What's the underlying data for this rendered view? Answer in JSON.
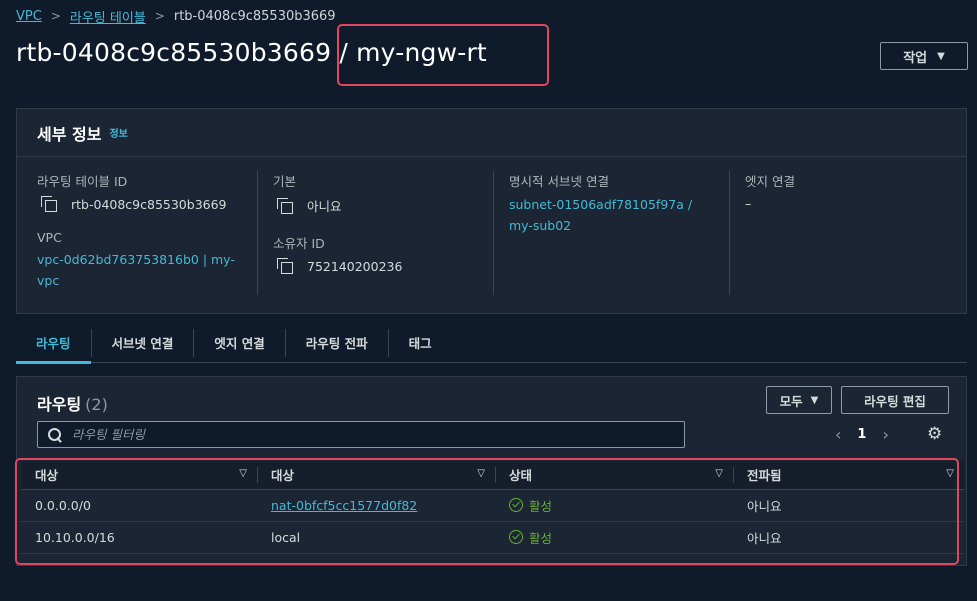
{
  "breadcrumb": {
    "items": [
      "VPC",
      "라우팅 테이블"
    ],
    "current": "rtb-0408c9c85530b3669"
  },
  "header": {
    "title": "rtb-0408c9c85530b3669 / my-ngw-rt",
    "action_label": "작업"
  },
  "details": {
    "title": "세부 정보",
    "info_link": "정보",
    "fields": {
      "route_table_id_label": "라우팅 테이블 ID",
      "route_table_id_value": "rtb-0408c9c85530b3669",
      "vpc_label": "VPC",
      "vpc_value": "vpc-0d62bd763753816b0 | my-vpc",
      "main_label": "기본",
      "main_value": "아니요",
      "owner_label": "소유자 ID",
      "owner_value": "752140200236",
      "subnet_assoc_label": "명시적 서브넷 연결",
      "subnet_assoc_value": "subnet-01506adf78105f97a / my-sub02",
      "edge_assoc_label": "엣지 연결",
      "edge_assoc_value": "–"
    }
  },
  "tabs": [
    "라우팅",
    "서브넷 연결",
    "엣지 연결",
    "라우팅 전파",
    "태그"
  ],
  "routes": {
    "title": "라우팅",
    "count": "(2)",
    "filter_select": "모두",
    "edit_button": "라우팅 편집",
    "search_placeholder": "라우팅 필터링",
    "page": "1",
    "columns": [
      "대상",
      "대상",
      "상태",
      "전파됨"
    ],
    "rows": [
      {
        "destination": "0.0.0.0/0",
        "target": "nat-0bfcf5cc1577d0f82",
        "target_is_link": true,
        "status": "활성",
        "propagated": "아니요"
      },
      {
        "destination": "10.10.0.0/16",
        "target": "local",
        "target_is_link": false,
        "status": "활성",
        "propagated": "아니요"
      }
    ]
  },
  "colors": {
    "background": "#0f1b2a",
    "panel": "#1b2533",
    "link": "#44b9d6",
    "success": "#69ae34",
    "highlight": "#e0475e"
  }
}
